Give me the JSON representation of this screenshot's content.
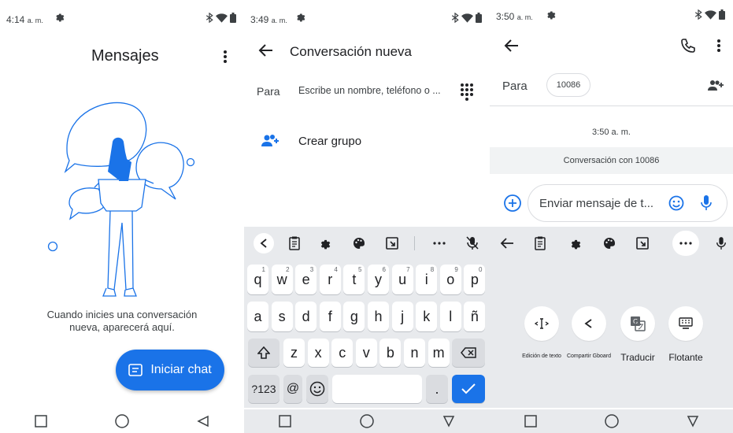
{
  "panel1": {
    "status": {
      "time": "4:14",
      "ampm": "a. m."
    },
    "title": "Mensajes",
    "empty_state": "Cuando inicies una conversación nueva, aparecerá aquí.",
    "fab_label": "Iniciar chat"
  },
  "panel2": {
    "status": {
      "time": "3:49",
      "ampm": "a. m."
    },
    "title": "Conversación nueva",
    "to_label": "Para",
    "to_placeholder": "Escribe un nombre, teléfono o ...",
    "create_group": "Crear grupo",
    "keyboard": {
      "row1": [
        {
          "k": "q",
          "n": "1"
        },
        {
          "k": "w",
          "n": "2"
        },
        {
          "k": "e",
          "n": "3"
        },
        {
          "k": "r",
          "n": "4"
        },
        {
          "k": "t",
          "n": "5"
        },
        {
          "k": "y",
          "n": "6"
        },
        {
          "k": "u",
          "n": "7"
        },
        {
          "k": "i",
          "n": "8"
        },
        {
          "k": "o",
          "n": "9"
        },
        {
          "k": "p",
          "n": "0"
        }
      ],
      "row2": [
        "a",
        "s",
        "d",
        "f",
        "g",
        "h",
        "j",
        "k",
        "l",
        "ñ"
      ],
      "row3": [
        "z",
        "x",
        "c",
        "v",
        "b",
        "n",
        "m"
      ],
      "symbols": "?123",
      "at": "@",
      "period": "."
    }
  },
  "panel3": {
    "status": {
      "time": "3:50",
      "ampm": "a. m."
    },
    "to_label": "Para",
    "recipient": "10086",
    "message_time": "3:50 a. m.",
    "conversation_with": "Conversación con 10086",
    "compose_placeholder": "Enviar mensaje de t...",
    "tools": [
      {
        "label": "Edición de texto",
        "icon": "text-cursor-icon"
      },
      {
        "label": "Compartir Gboard",
        "icon": "share-icon"
      },
      {
        "label": "Traducir",
        "icon": "translate-icon"
      },
      {
        "label": "Flotante",
        "icon": "floating-keyboard-icon"
      }
    ]
  },
  "colors": {
    "accent": "#1a73e8",
    "keyboard_bg": "#e8eaed",
    "text": "#202124"
  }
}
